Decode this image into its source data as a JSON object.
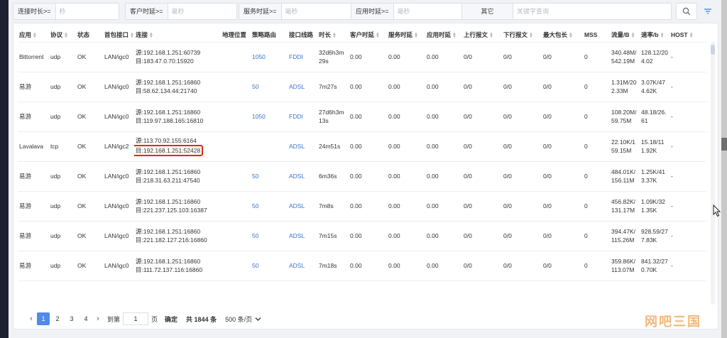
{
  "filters": [
    {
      "label": "连接时长>=",
      "placeholder": "秒"
    },
    {
      "label": "客户时延>=",
      "placeholder": "毫秒"
    },
    {
      "label": "服务时延>=",
      "placeholder": "毫秒"
    },
    {
      "label": "应用时延>=",
      "placeholder": "毫秒"
    },
    {
      "label": "其它",
      "placeholder": "关键字查询"
    }
  ],
  "table": {
    "columns": [
      "应用",
      "协议",
      "状态",
      "首包接口",
      "连接",
      "地理位置",
      "策略路由",
      "接口线路",
      "时长",
      "客户时延",
      "服务时延",
      "应用时延",
      "上行报文",
      "下行报文",
      "最大包长",
      "MSS",
      "流量/B",
      "速率/b",
      "HOST"
    ],
    "rows": [
      {
        "app": "Bittorrent",
        "proto": "udp",
        "status": "OK",
        "iface": "LAN/igc0",
        "conn_src": "源:192.168.1.251:60739",
        "conn_dst": "目:183.47.0.70:15920",
        "geo": "",
        "route": "1050",
        "line": "FDDI",
        "duration": "32d6h3m29s",
        "client": "0.00",
        "server": "0.00",
        "app_delay": "0.00",
        "up": "0/0",
        "down": "0/0",
        "maxpkt": "0/0",
        "mss": "0",
        "traffic": "340.48M/542.19M",
        "rate": "128.12/204.02",
        "host": "-"
      },
      {
        "app": "易游",
        "proto": "udp",
        "status": "OK",
        "iface": "LAN/igc0",
        "conn_src": "源:192.168.1.251:16860",
        "conn_dst": "目:58.62.134.44:21740",
        "geo": "",
        "route": "50",
        "line": "ADSL",
        "duration": "7m27s",
        "client": "0.00",
        "server": "0.00",
        "app_delay": "0.00",
        "up": "0/0",
        "down": "0/0",
        "maxpkt": "0/0",
        "mss": "0",
        "traffic": "1.31M/202.33M",
        "rate": "3.07K/474.62K",
        "host": "-"
      },
      {
        "app": "易游",
        "proto": "udp",
        "status": "OK",
        "iface": "LAN/igc0",
        "conn_src": "源:192.168.1.251:16860",
        "conn_dst": "目:119.97.188.165:16810",
        "geo": "",
        "route": "1050",
        "line": "FDDI",
        "duration": "27d6h3m13s",
        "client": "0.00",
        "server": "0.00",
        "app_delay": "0.00",
        "up": "0/0",
        "down": "0/0",
        "maxpkt": "0/0",
        "mss": "0",
        "traffic": "108.20M/59.75M",
        "rate": "48.18/26.61",
        "host": "-"
      },
      {
        "app": "Lavalava",
        "proto": "tcp",
        "status": "OK",
        "iface": "LAN/igc2",
        "conn_src": "源:113.70.92.155:6164",
        "conn_dst": "目:192.168.1.251:52428",
        "geo": "",
        "route": "",
        "line": "ADSL",
        "duration": "24m51s",
        "client": "0.00",
        "server": "0.00",
        "app_delay": "0.00",
        "up": "0/0",
        "down": "0/0",
        "maxpkt": "0/0",
        "mss": "0",
        "traffic": "22.10K/159.15M",
        "rate": "15.18/111.92K",
        "host": "-"
      },
      {
        "app": "易游",
        "proto": "udp",
        "status": "OK",
        "iface": "LAN/igc0",
        "conn_src": "源:192.168.1.251:16860",
        "conn_dst": "目:218.31.63.211:47540",
        "geo": "",
        "route": "50",
        "line": "ADSL",
        "duration": "6m36s",
        "client": "0.00",
        "server": "0.00",
        "app_delay": "0.00",
        "up": "0/0",
        "down": "0/0",
        "maxpkt": "0/0",
        "mss": "0",
        "traffic": "484.01K/156.11M",
        "rate": "1.25K/413.37K",
        "host": "-"
      },
      {
        "app": "易游",
        "proto": "udp",
        "status": "OK",
        "iface": "LAN/igc0",
        "conn_src": "源:192.168.1.251:16860",
        "conn_dst": "目:221.237.125.103:16387",
        "geo": "",
        "route": "50",
        "line": "ADSL",
        "duration": "7m8s",
        "client": "0.00",
        "server": "0.00",
        "app_delay": "0.00",
        "up": "0/0",
        "down": "0/0",
        "maxpkt": "0/0",
        "mss": "0",
        "traffic": "456.82K/131.17M",
        "rate": "1.09K/321.35K",
        "host": "-"
      },
      {
        "app": "易游",
        "proto": "udp",
        "status": "OK",
        "iface": "LAN/igc0",
        "conn_src": "源:192.168.1.251:16860",
        "conn_dst": "目:221.182.127.216:16860",
        "geo": "",
        "route": "50",
        "line": "ADSL",
        "duration": "7m15s",
        "client": "0.00",
        "server": "0.00",
        "app_delay": "0.00",
        "up": "0/0",
        "down": "0/0",
        "maxpkt": "0/0",
        "mss": "0",
        "traffic": "394.47K/115.26M",
        "rate": "928.59/277.83K",
        "host": "-"
      },
      {
        "app": "易游",
        "proto": "udp",
        "status": "OK",
        "iface": "LAN/igc0",
        "conn_src": "源:192.168.1.251:16860",
        "conn_dst": "目:111.72.137.116:16860",
        "geo": "",
        "route": "50",
        "line": "ADSL",
        "duration": "7m18s",
        "client": "0.00",
        "server": "0.00",
        "app_delay": "0.00",
        "up": "0/0",
        "down": "0/0",
        "maxpkt": "0/0",
        "mss": "0",
        "traffic": "359.86K/113.07M",
        "rate": "841.32/270.70K",
        "host": "-"
      }
    ]
  },
  "pagination": {
    "pages": [
      "1",
      "2",
      "3",
      "4"
    ],
    "goto_label": "到第",
    "page_value": "1",
    "page_unit": "页",
    "confirm_label": "确定",
    "total_label": "共 1844 条",
    "size_label": "500 条/页"
  },
  "watermark": "网吧三国",
  "icons": {
    "search": "search-icon",
    "filter": "filter-lines-icon",
    "prev": "chevron-left-icon",
    "next": "chevron-right-icon",
    "dropdown": "chevron-down-icon"
  },
  "colors": {
    "accent": "#4f8be8",
    "link": "#3a73c8",
    "highlight": "#e8231c"
  }
}
